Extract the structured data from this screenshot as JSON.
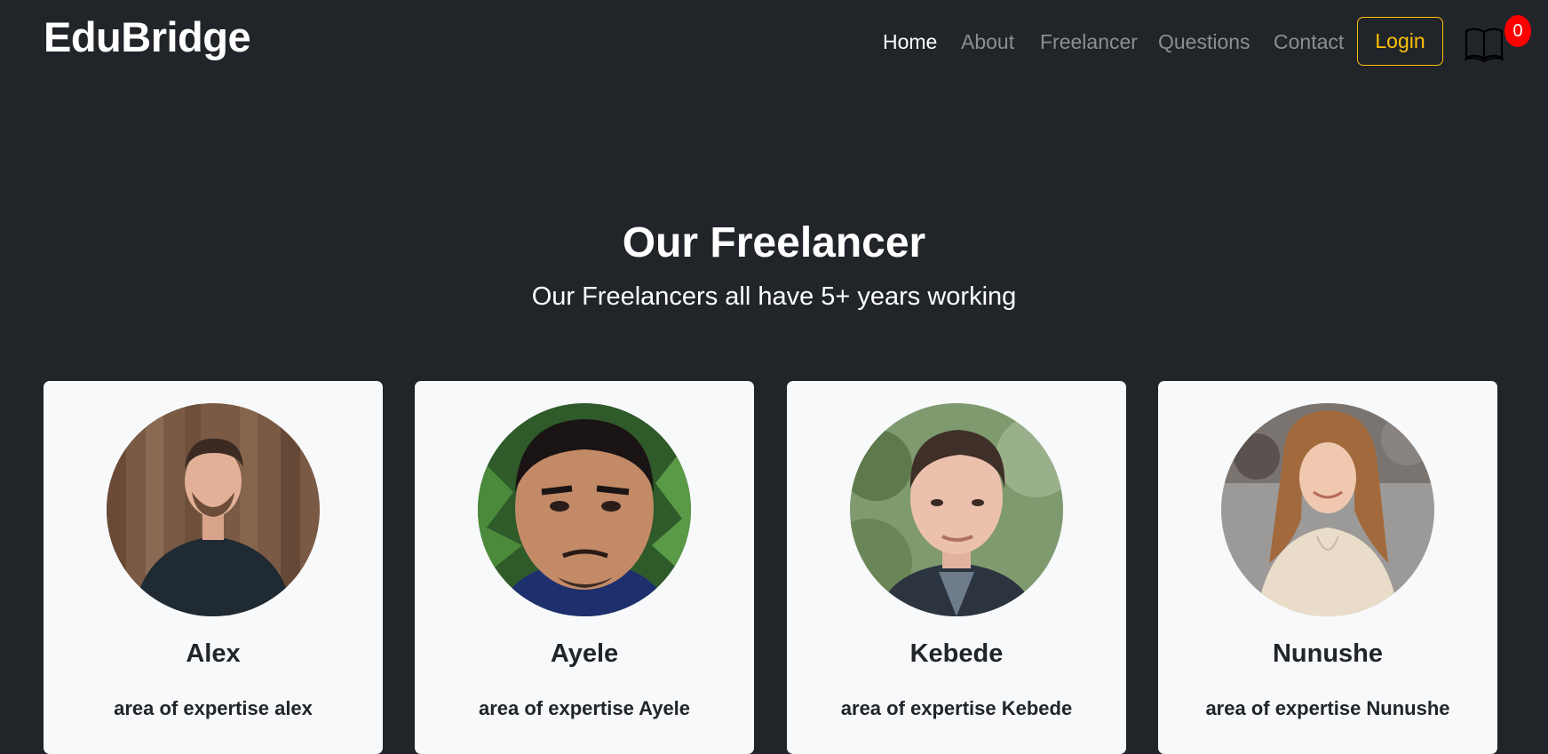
{
  "brand": "EduBridge",
  "nav": {
    "items": [
      {
        "label": "Home"
      },
      {
        "label": "About"
      },
      {
        "label": "Freelancer"
      },
      {
        "label": "Questions"
      },
      {
        "label": "Contact"
      }
    ],
    "login_label": "Login",
    "cart_count": "0",
    "cart_icon": "book-icon"
  },
  "colors": {
    "background": "#212529",
    "accent": "#ffc107",
    "badge": "#ff0000",
    "card": "#f8f9fa"
  },
  "section": {
    "title": "Our Freelancer",
    "subtitle": "Our Freelancers all have 5+ years working"
  },
  "freelancers": [
    {
      "name": "Alex",
      "expertise": "area of expertise alex"
    },
    {
      "name": "Ayele",
      "expertise": "area of expertise Ayele"
    },
    {
      "name": "Kebede",
      "expertise": "area of expertise Kebede"
    },
    {
      "name": "Nunushe",
      "expertise": "area of expertise Nunushe"
    }
  ]
}
